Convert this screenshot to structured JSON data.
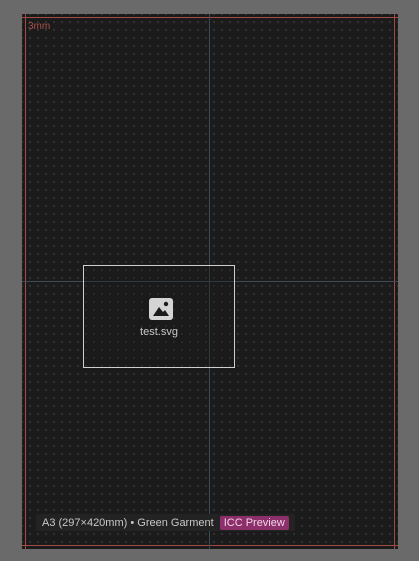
{
  "artboard": {
    "bleed_label": "3mm"
  },
  "placed_item": {
    "icon": "image-icon",
    "file_name": "test.svg"
  },
  "status_bar": {
    "document_info": "A3 (297×420mm) • Green Garment",
    "icc_badge": "ICC Preview"
  },
  "colors": {
    "workspace": "#6a6a6a",
    "artboard": "#1b1b1b",
    "bleed_line": "#a24a44",
    "guide": "#3c4a55",
    "icc_badge": "#8c2f6a"
  }
}
